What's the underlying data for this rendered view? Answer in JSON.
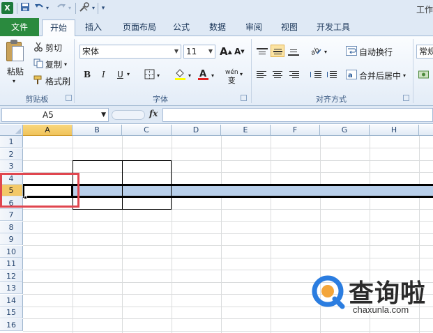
{
  "app": {
    "window_title": "工作"
  },
  "quick_access": {
    "save_icon": "save-icon",
    "undo_icon": "undo-icon",
    "redo_icon": "redo-icon",
    "customize_icon": "customize-icon"
  },
  "tabs": [
    {
      "label": "文件"
    },
    {
      "label": "开始"
    },
    {
      "label": "插入"
    },
    {
      "label": "页面布局"
    },
    {
      "label": "公式"
    },
    {
      "label": "数据"
    },
    {
      "label": "审阅"
    },
    {
      "label": "视图"
    },
    {
      "label": "开发工具"
    }
  ],
  "active_tab": "开始",
  "ribbon": {
    "clipboard": {
      "paste": "粘贴",
      "cut": "剪切",
      "copy": "复制",
      "format_painter": "格式刷",
      "group": "剪贴板"
    },
    "font": {
      "name": "宋体",
      "size": "11",
      "bold": "B",
      "italic": "I",
      "underline": "U",
      "wen": "wén",
      "group": "字体",
      "grow": "A",
      "shrink": "A"
    },
    "alignment": {
      "wrap_text": "自动换行",
      "merge_center": "合并后居中",
      "group": "对齐方式"
    },
    "number": {
      "format": "常规"
    }
  },
  "formula_bar": {
    "name_box": "A5",
    "fx": "fx",
    "formula": ""
  },
  "grid": {
    "columns": [
      "A",
      "B",
      "C",
      "D",
      "E",
      "F",
      "G",
      "H"
    ],
    "rows": [
      "1",
      "2",
      "3",
      "4",
      "5",
      "6",
      "7",
      "8",
      "9",
      "10",
      "11",
      "12",
      "13",
      "14",
      "15",
      "16"
    ],
    "selected_row": "5",
    "active_cell": "A5"
  },
  "watermark": {
    "text": "查询啦",
    "url": "chaxunla.com"
  },
  "colors": {
    "file_tab": "#2a8a3e",
    "selection": "#b8cfea",
    "highlight_frame": "#e0464f",
    "header_selected": "#f3c969"
  }
}
